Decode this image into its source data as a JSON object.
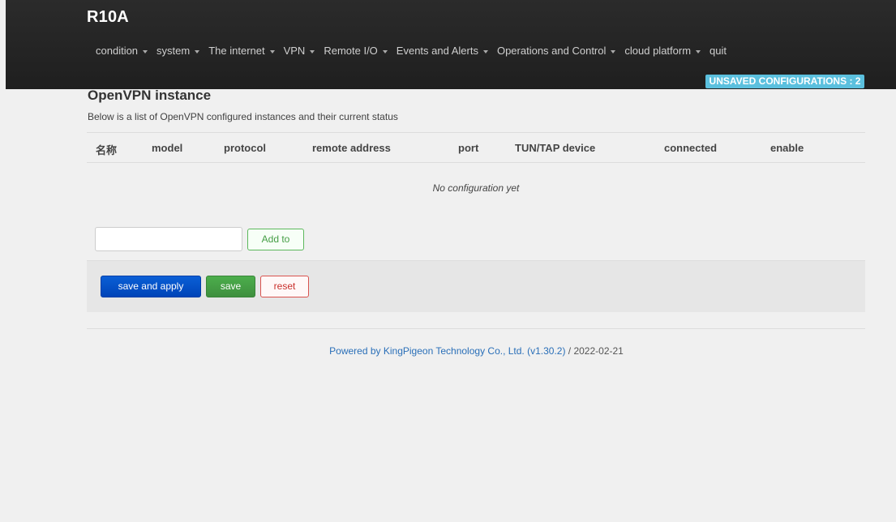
{
  "app": {
    "brand": "R10A"
  },
  "nav": {
    "items": [
      {
        "label": "condition",
        "dropdown": true
      },
      {
        "label": "system",
        "dropdown": true
      },
      {
        "label": "The internet",
        "dropdown": true
      },
      {
        "label": "VPN",
        "dropdown": true
      },
      {
        "label": "Remote I/O",
        "dropdown": true
      },
      {
        "label": "Events and Alerts",
        "dropdown": true
      },
      {
        "label": "Operations and Control",
        "dropdown": true
      },
      {
        "label": "cloud platform",
        "dropdown": true
      },
      {
        "label": "quit",
        "dropdown": false
      }
    ]
  },
  "badge": {
    "text": "UNSAVED CONFIGURATIONS : 2",
    "color": "#5bc0de"
  },
  "section": {
    "title": "OpenVPN instance",
    "description": "Below is a list of OpenVPN configured instances and their current status"
  },
  "table": {
    "columns": [
      "名称",
      "model",
      "protocol",
      "remote address",
      "port",
      "TUN/TAP device",
      "connected",
      "enable"
    ],
    "empty_text": "No configuration yet"
  },
  "add": {
    "input_value": "",
    "button_label": "Add to"
  },
  "actions": {
    "save_apply_label": "save and apply",
    "save_label": "save",
    "reset_label": "reset"
  },
  "footer": {
    "link_text": "Powered by KingPigeon Technology Co., Ltd. (v1.30.2)",
    "date_text": " / 2022-02-21"
  },
  "colors": {
    "topbar": "#222222",
    "primary": "#0044b8",
    "success": "#449d44",
    "danger": "#d9534f",
    "info": "#5bc0de"
  }
}
